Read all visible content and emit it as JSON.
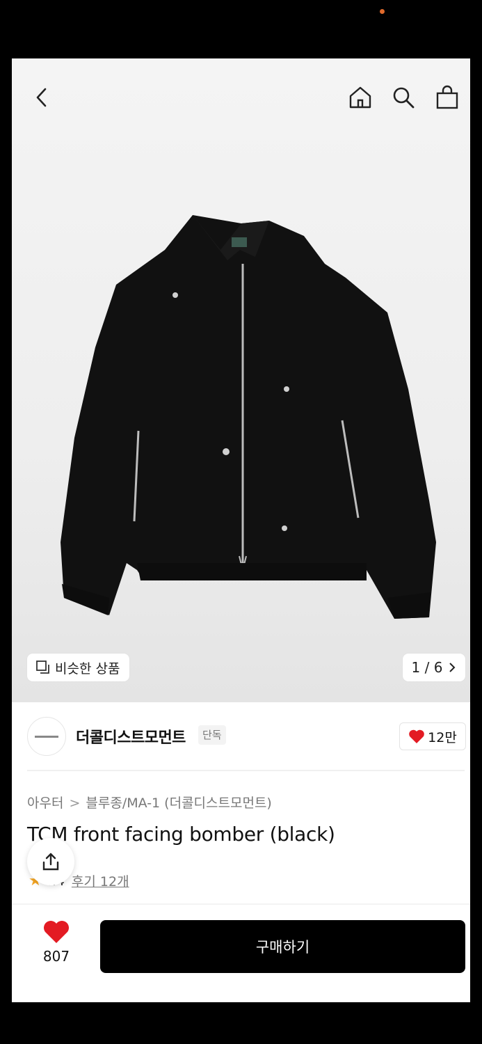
{
  "gallery": {
    "similar_label": "비슷한 상품",
    "counter": "1 / 6"
  },
  "brand": {
    "name": "더콜디스트모먼트",
    "badge": "단독",
    "likes": "12만"
  },
  "product": {
    "breadcrumb": [
      "아우터",
      "블루종/MA-1 (더콜디스트모먼트)"
    ],
    "title": "TCM front facing bomber (black)",
    "rating_visible": "..4",
    "reviews_label": "후기 12개"
  },
  "footer": {
    "wish_count": "807",
    "buy_label": "구매하기"
  },
  "colors": {
    "accent_heart": "#e31b23",
    "buy_button": "#000000",
    "star": "#f5a623"
  },
  "icons": [
    "back-icon",
    "home-icon",
    "search-icon",
    "bag-icon",
    "similar-icon",
    "chevron-right-icon",
    "heart-icon",
    "share-icon",
    "star-icon"
  ]
}
